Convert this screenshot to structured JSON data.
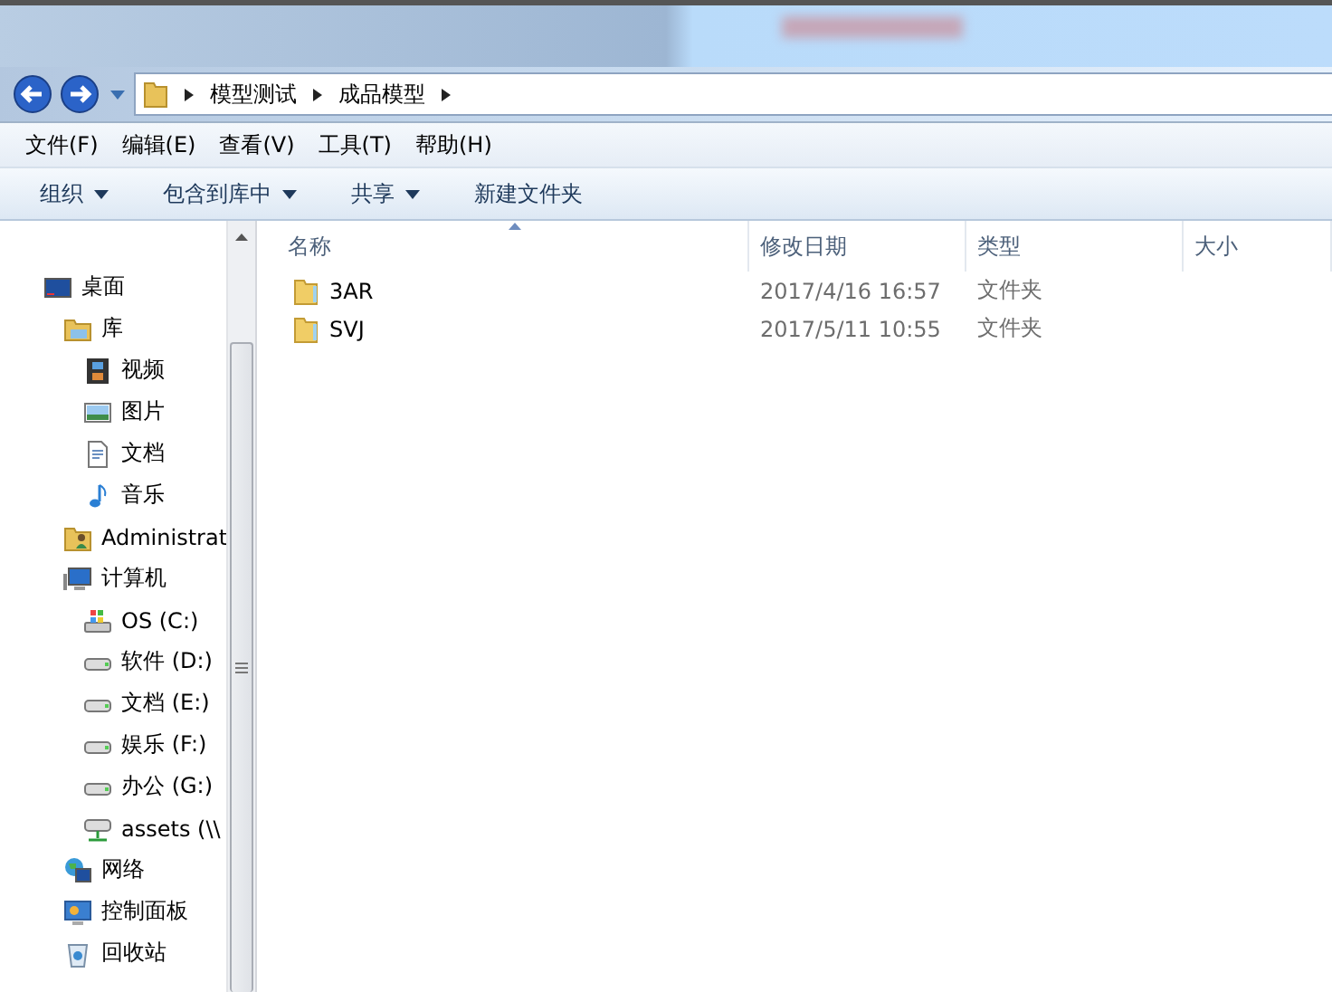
{
  "address_bar": {
    "segments": [
      "模型测试",
      "成品模型"
    ]
  },
  "menu_bar": [
    "文件(F)",
    "编辑(E)",
    "查看(V)",
    "工具(T)",
    "帮助(H)"
  ],
  "toolbar": [
    {
      "label": "组织",
      "dropdown": true
    },
    {
      "label": "包含到库中",
      "dropdown": true
    },
    {
      "label": "共享",
      "dropdown": true
    },
    {
      "label": "新建文件夹",
      "dropdown": false
    }
  ],
  "sidebar": {
    "items": [
      {
        "label": "桌面",
        "kind": "desktop",
        "children": [
          {
            "label": "库",
            "kind": "library",
            "children": [
              {
                "label": "视频",
                "kind": "video"
              },
              {
                "label": "图片",
                "kind": "picture"
              },
              {
                "label": "文档",
                "kind": "document"
              },
              {
                "label": "音乐",
                "kind": "music"
              }
            ]
          },
          {
            "label": "Administrat",
            "kind": "user-folder"
          },
          {
            "label": "计算机",
            "kind": "computer",
            "children": [
              {
                "label": "OS (C:)",
                "kind": "os-drive"
              },
              {
                "label": "软件 (D:)",
                "kind": "drive"
              },
              {
                "label": "文档 (E:)",
                "kind": "drive"
              },
              {
                "label": "娱乐 (F:)",
                "kind": "drive"
              },
              {
                "label": "办公 (G:)",
                "kind": "drive"
              },
              {
                "label": "assets (\\\\",
                "kind": "network-drive"
              }
            ]
          },
          {
            "label": "网络",
            "kind": "network"
          },
          {
            "label": "控制面板",
            "kind": "control-panel"
          },
          {
            "label": "回收站",
            "kind": "recycle-bin"
          }
        ]
      }
    ]
  },
  "table": {
    "columns": [
      "名称",
      "修改日期",
      "类型",
      "大小"
    ],
    "rows": [
      {
        "name": "3AR",
        "modified": "2017/4/16 16:57",
        "type": "文件夹"
      },
      {
        "name": "SVJ",
        "modified": "2017/5/11 10:55",
        "type": "文件夹"
      }
    ]
  }
}
